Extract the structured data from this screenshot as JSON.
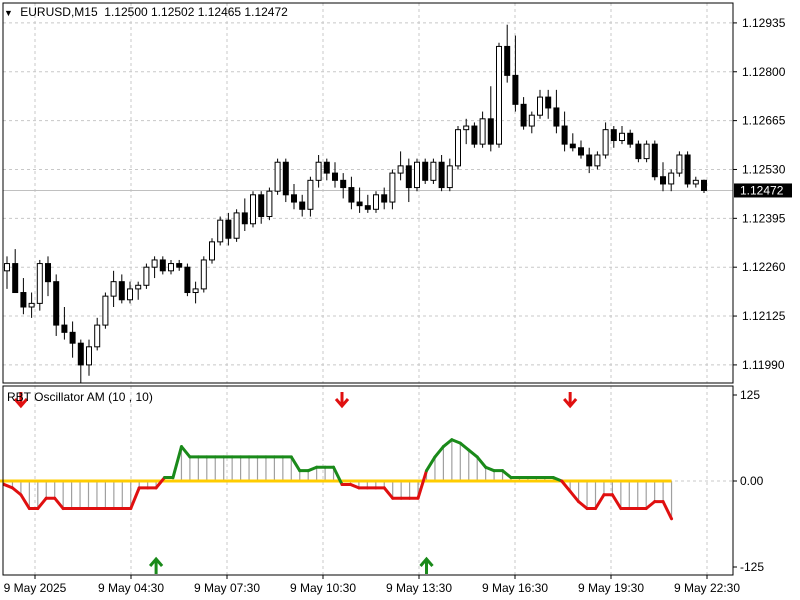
{
  "main_chart": {
    "symbol": "EURUSD,M15",
    "ohlc": "1.12500 1.12502 1.12465 1.12472",
    "price_axis": [
      "1.12935",
      "1.12800",
      "1.12665",
      "1.12530",
      "1.12395",
      "1.12260",
      "1.12125",
      "1.11990"
    ],
    "current_price": "1.12472",
    "colors": {
      "bull": "#ffffff",
      "bear": "#000000",
      "wick": "#000000",
      "grid": "#c8c8c8",
      "price_line": "#c0c0c0"
    }
  },
  "indicator": {
    "title": "RBT Oscillator AM (10 , 10)",
    "axis_labels": [
      "125",
      "0.00",
      "-125"
    ],
    "colors": {
      "up": "#1a8a1a",
      "down": "#e01010",
      "zero": "#ffcc00",
      "hist": "#a0a0a0"
    }
  },
  "time_axis": [
    "9 May 2025",
    "9 May 04:30",
    "9 May 07:30",
    "9 May 10:30",
    "9 May 13:30",
    "9 May 16:30",
    "9 May 19:30",
    "9 May 22:30"
  ],
  "signals": [
    {
      "type": "sell",
      "icon": "arrow-down-icon",
      "color": "#e01010"
    },
    {
      "type": "sell",
      "icon": "arrow-down-icon",
      "color": "#e01010"
    },
    {
      "type": "sell",
      "icon": "arrow-down-icon",
      "color": "#e01010"
    },
    {
      "type": "buy",
      "icon": "arrow-up-icon",
      "color": "#1a8a1a"
    },
    {
      "type": "buy",
      "icon": "arrow-up-icon",
      "color": "#1a8a1a"
    }
  ],
  "chart_data": {
    "type": "candlestick",
    "candles": [
      [
        1.1225,
        1.1229,
        1.122,
        1.1227
      ],
      [
        1.1227,
        1.1231,
        1.1219,
        1.1219
      ],
      [
        1.1219,
        1.1223,
        1.1213,
        1.1215
      ],
      [
        1.1215,
        1.1219,
        1.1212,
        1.1216
      ],
      [
        1.1216,
        1.1228,
        1.1214,
        1.1227
      ],
      [
        1.1227,
        1.1229,
        1.1218,
        1.1222
      ],
      [
        1.1222,
        1.1224,
        1.1207,
        1.121
      ],
      [
        1.121,
        1.1215,
        1.1206,
        1.1208
      ],
      [
        1.1208,
        1.1211,
        1.1201,
        1.1205
      ],
      [
        1.1205,
        1.1206,
        1.1194,
        1.1199
      ],
      [
        1.1199,
        1.1206,
        1.1196,
        1.1204
      ],
      [
        1.1204,
        1.1212,
        1.1203,
        1.121
      ],
      [
        1.121,
        1.1219,
        1.1209,
        1.1218
      ],
      [
        1.1218,
        1.1225,
        1.1215,
        1.1222
      ],
      [
        1.1222,
        1.1224,
        1.1216,
        1.1217
      ],
      [
        1.1217,
        1.1222,
        1.1216,
        1.122
      ],
      [
        1.122,
        1.1222,
        1.1217,
        1.1221
      ],
      [
        1.1221,
        1.1227,
        1.122,
        1.1226
      ],
      [
        1.1226,
        1.1229,
        1.1223,
        1.1228
      ],
      [
        1.1228,
        1.1229,
        1.1224,
        1.1225
      ],
      [
        1.1225,
        1.1228,
        1.1224,
        1.1227
      ],
      [
        1.1227,
        1.1228,
        1.1225,
        1.1226
      ],
      [
        1.1226,
        1.1227,
        1.1218,
        1.1219
      ],
      [
        1.1219,
        1.1222,
        1.1216,
        1.122
      ],
      [
        1.122,
        1.1229,
        1.1219,
        1.1228
      ],
      [
        1.1228,
        1.1234,
        1.1227,
        1.1233
      ],
      [
        1.1233,
        1.124,
        1.1232,
        1.1239
      ],
      [
        1.1239,
        1.1241,
        1.1232,
        1.1234
      ],
      [
        1.1234,
        1.1242,
        1.1233,
        1.1241
      ],
      [
        1.1241,
        1.1245,
        1.1236,
        1.1238
      ],
      [
        1.1238,
        1.1247,
        1.1237,
        1.1246
      ],
      [
        1.1246,
        1.1247,
        1.1238,
        1.124
      ],
      [
        1.124,
        1.1248,
        1.1239,
        1.1247
      ],
      [
        1.1247,
        1.1256,
        1.1246,
        1.1255
      ],
      [
        1.1255,
        1.1256,
        1.1244,
        1.1246
      ],
      [
        1.1246,
        1.1249,
        1.1242,
        1.1244
      ],
      [
        1.1244,
        1.1246,
        1.124,
        1.1242
      ],
      [
        1.1242,
        1.1251,
        1.124,
        1.125
      ],
      [
        1.125,
        1.1257,
        1.1248,
        1.1255
      ],
      [
        1.1255,
        1.1256,
        1.125,
        1.1252
      ],
      [
        1.1252,
        1.1255,
        1.1248,
        1.125
      ],
      [
        1.125,
        1.1252,
        1.1245,
        1.1248
      ],
      [
        1.1248,
        1.1251,
        1.1242,
        1.1244
      ],
      [
        1.1244,
        1.1248,
        1.1241,
        1.1243
      ],
      [
        1.1243,
        1.1246,
        1.1241,
        1.1242
      ],
      [
        1.1242,
        1.1247,
        1.1241,
        1.1246
      ],
      [
        1.1246,
        1.1248,
        1.1242,
        1.1244
      ],
      [
        1.1244,
        1.1253,
        1.1242,
        1.1252
      ],
      [
        1.1252,
        1.1258,
        1.125,
        1.1254
      ],
      [
        1.1254,
        1.1256,
        1.1244,
        1.1248
      ],
      [
        1.1248,
        1.1256,
        1.1247,
        1.1255
      ],
      [
        1.1255,
        1.1256,
        1.1249,
        1.125
      ],
      [
        1.125,
        1.1256,
        1.1249,
        1.1255
      ],
      [
        1.1255,
        1.1257,
        1.1247,
        1.1248
      ],
      [
        1.1248,
        1.1256,
        1.1247,
        1.1254
      ],
      [
        1.1254,
        1.1265,
        1.1253,
        1.1264
      ],
      [
        1.1264,
        1.1267,
        1.126,
        1.1265
      ],
      [
        1.1265,
        1.1266,
        1.1259,
        1.126
      ],
      [
        1.126,
        1.1269,
        1.1259,
        1.1267
      ],
      [
        1.1267,
        1.1276,
        1.1258,
        1.126
      ],
      [
        1.126,
        1.1288,
        1.1259,
        1.1287
      ],
      [
        1.1287,
        1.1293,
        1.1277,
        1.1279
      ],
      [
        1.1279,
        1.129,
        1.1269,
        1.1271
      ],
      [
        1.1271,
        1.1273,
        1.1264,
        1.1265
      ],
      [
        1.1265,
        1.1269,
        1.1263,
        1.1268
      ],
      [
        1.1268,
        1.1275,
        1.1267,
        1.1273
      ],
      [
        1.1273,
        1.1275,
        1.1267,
        1.127
      ],
      [
        1.127,
        1.1275,
        1.1263,
        1.1265
      ],
      [
        1.1265,
        1.1269,
        1.1258,
        1.126
      ],
      [
        1.126,
        1.1263,
        1.1258,
        1.1259
      ],
      [
        1.1259,
        1.1261,
        1.1256,
        1.1257
      ],
      [
        1.1257,
        1.1259,
        1.1252,
        1.1254
      ],
      [
        1.1254,
        1.1258,
        1.1253,
        1.1257
      ],
      [
        1.1257,
        1.1266,
        1.1256,
        1.1264
      ],
      [
        1.1264,
        1.1265,
        1.1259,
        1.1261
      ],
      [
        1.1261,
        1.1265,
        1.126,
        1.1263
      ],
      [
        1.1263,
        1.1264,
        1.1259,
        1.126
      ],
      [
        1.126,
        1.1261,
        1.1255,
        1.1256
      ],
      [
        1.1256,
        1.1261,
        1.1255,
        1.126
      ],
      [
        1.126,
        1.1261,
        1.125,
        1.1251
      ],
      [
        1.1251,
        1.1255,
        1.1247,
        1.1249
      ],
      [
        1.1249,
        1.1253,
        1.1247,
        1.1252
      ],
      [
        1.1252,
        1.1258,
        1.1251,
        1.1257
      ],
      [
        1.1257,
        1.1258,
        1.1248,
        1.1249
      ],
      [
        1.1249,
        1.1251,
        1.1248,
        1.125
      ],
      [
        1.125,
        1.12502,
        1.12465,
        1.12472
      ]
    ],
    "oscillator": [
      -5,
      -10,
      -20,
      -40,
      -40,
      -25,
      -25,
      -40,
      -40,
      -40,
      -40,
      -40,
      -40,
      -40,
      -40,
      -40,
      -10,
      -10,
      -10,
      5,
      5,
      50,
      35,
      35,
      35,
      35,
      35,
      35,
      35,
      35,
      35,
      35,
      35,
      35,
      35,
      15,
      15,
      20,
      20,
      20,
      -5,
      -5,
      -10,
      -10,
      -10,
      -10,
      -25,
      -25,
      -25,
      -25,
      15,
      35,
      50,
      60,
      55,
      45,
      35,
      20,
      15,
      15,
      5,
      5,
      5,
      5,
      5,
      5,
      0,
      -15,
      -30,
      -40,
      -40,
      -20,
      -20,
      -40,
      -40,
      -40,
      -40,
      -30,
      -30,
      -55
    ],
    "signals": [
      {
        "pane": "indicator",
        "type": "sell",
        "bar": 2
      },
      {
        "pane": "indicator",
        "type": "sell",
        "bar": 40
      },
      {
        "pane": "indicator",
        "type": "sell",
        "bar": 67
      },
      {
        "pane": "indicator",
        "type": "buy",
        "bar": 18
      },
      {
        "pane": "indicator",
        "type": "buy",
        "bar": 50
      }
    ]
  }
}
